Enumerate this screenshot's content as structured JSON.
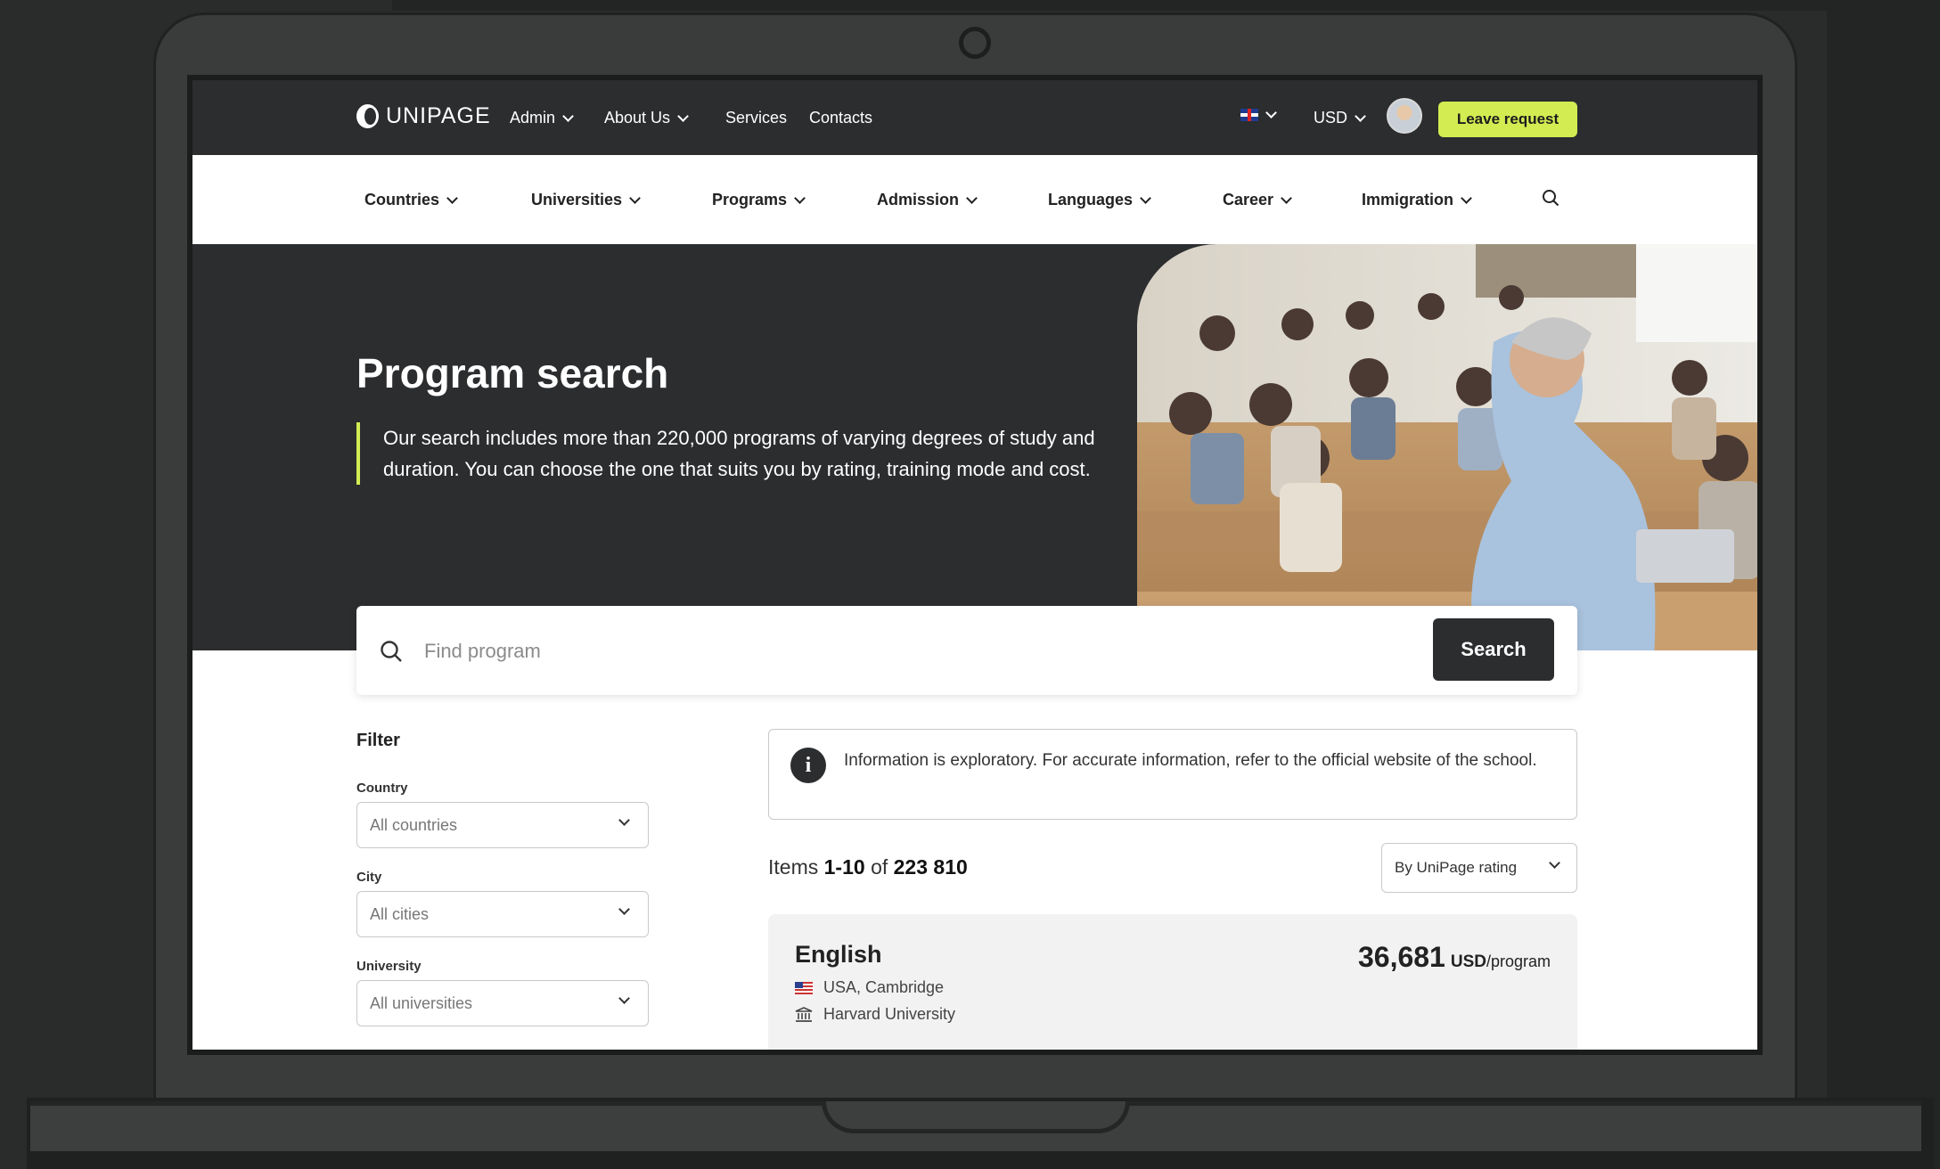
{
  "topbar": {
    "logo_text": "UNIPAGE",
    "nav": [
      "Admin",
      "About Us",
      "Services",
      "Contacts"
    ],
    "language_flag": "uk-flag",
    "currency": "USD",
    "leave_request": "Leave request"
  },
  "mainnav": {
    "items": [
      "Countries",
      "Universities",
      "Programs",
      "Admission",
      "Languages",
      "Career",
      "Immigration"
    ]
  },
  "hero": {
    "title": "Program search",
    "description": "Our search includes more than 220,000 programs of varying degrees of study and duration. You can choose the one that suits you by rating, training mode and cost."
  },
  "search": {
    "placeholder": "Find program",
    "button": "Search"
  },
  "filter": {
    "title": "Filter",
    "country_label": "Country",
    "country_value": "All countries",
    "city_label": "City",
    "city_value": "All cities",
    "university_label": "University",
    "university_value": "All universities"
  },
  "info": {
    "icon": "i",
    "text": "Information is exploratory. For accurate information, refer to the official website of the school."
  },
  "results": {
    "items_prefix": "Items",
    "range": "1-10",
    "of": "of",
    "total": "223 810",
    "sort": "By UniPage rating"
  },
  "card": {
    "title": "English",
    "price": "36,681",
    "currency": "USD",
    "unit": "/program",
    "location": "USA, Cambridge",
    "university": "Harvard University"
  },
  "colors": {
    "dark": "#2b2d2f",
    "accent": "#d3ec52"
  }
}
